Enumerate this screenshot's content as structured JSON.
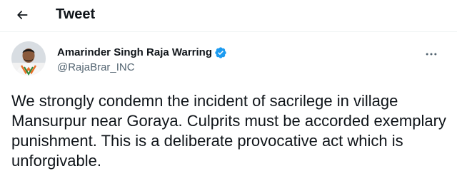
{
  "header": {
    "back_icon": "arrow-left-icon",
    "title": "Tweet"
  },
  "author": {
    "display_name": "Amarinder Singh Raja Warring",
    "handle": "@RajaBrar_INC",
    "verified_icon": "verified-badge-icon",
    "verified_color": "#1d9bf0"
  },
  "actions": {
    "more_icon": "more-horizontal-icon"
  },
  "tweet": {
    "text": "We strongly condemn the incident of sacrilege in village Mansurpur near Goraya. Culprits must be accorded exemplary punishment. This is a deliberate provocative act which is unforgivable."
  },
  "colors": {
    "text_primary": "#0f1419",
    "text_secondary": "#536471",
    "divider": "#eff3f4",
    "accent": "#1d9bf0"
  }
}
